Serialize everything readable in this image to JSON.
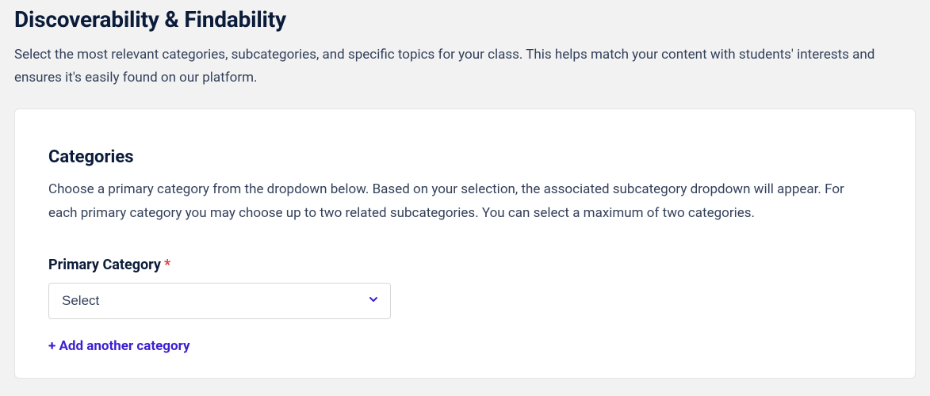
{
  "header": {
    "title": "Discoverability & Findability",
    "description": "Select the most relevant categories, subcategories, and specific topics for your class. This helps match your content with students' interests and ensures it's easily found on our platform."
  },
  "categories_card": {
    "title": "Categories",
    "description": "Choose a primary category from the dropdown below. Based on your selection, the associated subcategory dropdown will appear. For each primary category you may choose up to two related subcategories. You can select a maximum of two categories.",
    "primary_label": "Primary Category",
    "required_mark": "*",
    "select_placeholder": "Select",
    "add_link": "+ Add another category"
  },
  "colors": {
    "accent": "#3d1fd1"
  }
}
